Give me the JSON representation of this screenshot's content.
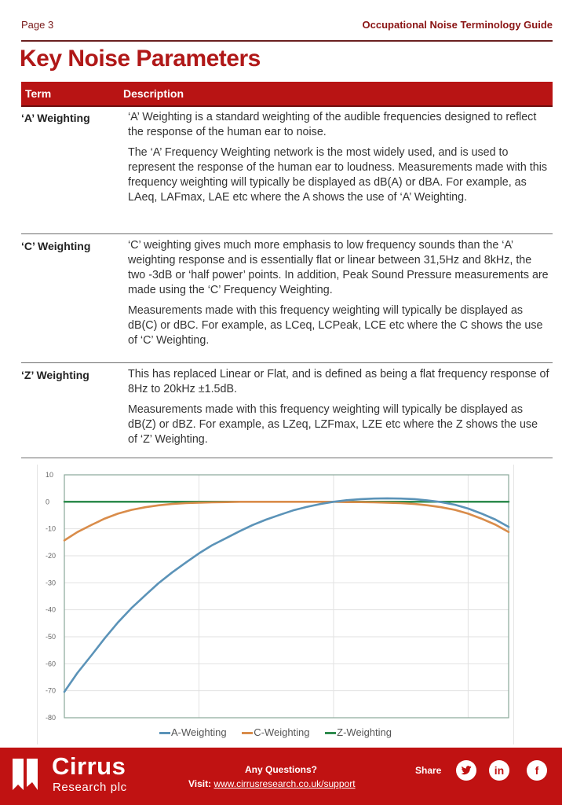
{
  "header": {
    "page_label": "Page 3",
    "guide_title": "Occupational Noise Terminology Guide"
  },
  "title": "Key Noise Parameters",
  "table": {
    "columns": [
      "Term",
      "Description"
    ],
    "rows": [
      {
        "term": "‘A’ Weighting",
        "paragraphs": [
          "‘A’ Weighting is a standard weighting of the audible frequencies designed to reflect the response of the human ear to noise.",
          "The ‘A’ Frequency Weighting network is the most widely used, and is used to represent the response of the human ear to loudness. Measurements made with this frequency weighting will typically be displayed as dB(A) or dBA. For example, as LAeq, LAFmax, LAE etc where the A shows the use of ‘A’ Weighting."
        ]
      },
      {
        "term": "‘C’ Weighting",
        "paragraphs": [
          "‘C’ weighting gives much more emphasis to low frequency sounds than the ‘A’ weighting response and is essentially flat or linear between 31,5Hz and 8kHz, the two -3dB or ‘half power’ points. In addition, Peak Sound Pressure measurements are made using the ‘C’ Frequency Weighting.",
          "Measurements made with this frequency weighting will typically be displayed as dB(C) or dBC.  For example, as LCeq, LCPeak, LCE etc where the C shows the use of ‘C’ Weighting."
        ]
      },
      {
        "term": "‘Z’ Weighting",
        "paragraphs": [
          "This has replaced Linear or Flat, and is defined as being a flat frequency response of 8Hz to 20kHz ±1.5dB.",
          "Measurements made with this frequency weighting will typically be displayed as dB(Z) or dBZ. For example, as LZeq, LZFmax, LZE etc where the Z shows the use of ‘Z’ Weighting."
        ]
      }
    ]
  },
  "chart_data": {
    "type": "line",
    "title": "",
    "xlabel": "",
    "ylabel": "",
    "x_scale": "log",
    "x_unit": "Hz",
    "x_tick_labels_visible": false,
    "xlim": [
      10,
      20000
    ],
    "x_gridlines": [
      100,
      1000,
      10000
    ],
    "ylim": [
      -80,
      10
    ],
    "y_ticks": [
      10,
      0,
      -10,
      -20,
      -30,
      -40,
      -50,
      -60,
      -70,
      -80
    ],
    "grid": true,
    "legend_position": "bottom",
    "x": [
      10,
      12.5,
      16,
      20,
      25,
      31.5,
      40,
      50,
      63,
      80,
      100,
      125,
      160,
      200,
      250,
      315,
      400,
      500,
      630,
      800,
      1000,
      1250,
      1600,
      2000,
      2500,
      3150,
      4000,
      5000,
      6300,
      8000,
      10000,
      12500,
      16000,
      20000
    ],
    "series": [
      {
        "name": "A-Weighting",
        "color": "#5b93b8",
        "values": [
          -70.4,
          -63.4,
          -56.7,
          -50.5,
          -44.7,
          -39.4,
          -34.6,
          -30.2,
          -26.2,
          -22.5,
          -19.1,
          -16.1,
          -13.4,
          -10.9,
          -8.6,
          -6.6,
          -4.8,
          -3.2,
          -1.9,
          -0.8,
          0.0,
          0.6,
          1.0,
          1.2,
          1.3,
          1.2,
          1.0,
          0.5,
          -0.1,
          -1.1,
          -2.5,
          -4.3,
          -6.6,
          -9.3
        ]
      },
      {
        "name": "C-Weighting",
        "color": "#d98c4a",
        "values": [
          -14.3,
          -11.2,
          -8.5,
          -6.2,
          -4.4,
          -3.0,
          -2.0,
          -1.3,
          -0.8,
          -0.5,
          -0.3,
          -0.2,
          -0.1,
          0.0,
          0.0,
          0.0,
          0.0,
          0.0,
          0.0,
          0.0,
          0.0,
          -0.1,
          -0.1,
          -0.2,
          -0.3,
          -0.5,
          -0.8,
          -1.3,
          -2.0,
          -3.0,
          -4.4,
          -6.2,
          -8.5,
          -11.2
        ]
      },
      {
        "name": "Z-Weighting",
        "color": "#2e8b4e",
        "values": [
          0,
          0,
          0,
          0,
          0,
          0,
          0,
          0,
          0,
          0,
          0,
          0,
          0,
          0,
          0,
          0,
          0,
          0,
          0,
          0,
          0,
          0,
          0,
          0,
          0,
          0,
          0,
          0,
          0,
          0,
          0,
          0,
          0,
          0
        ]
      }
    ]
  },
  "footer": {
    "brand_name": "Cirrus",
    "brand_sub": "Research plc",
    "questions": "Any Questions?",
    "visit_label": "Visit:",
    "visit_link": "www.cirrusresearch.co.uk/support",
    "share_label": "Share",
    "social": [
      {
        "name": "twitter",
        "glyph": "t"
      },
      {
        "name": "linkedin",
        "glyph": "in"
      },
      {
        "name": "facebook",
        "glyph": "f"
      }
    ],
    "background_color": "#c01212"
  }
}
